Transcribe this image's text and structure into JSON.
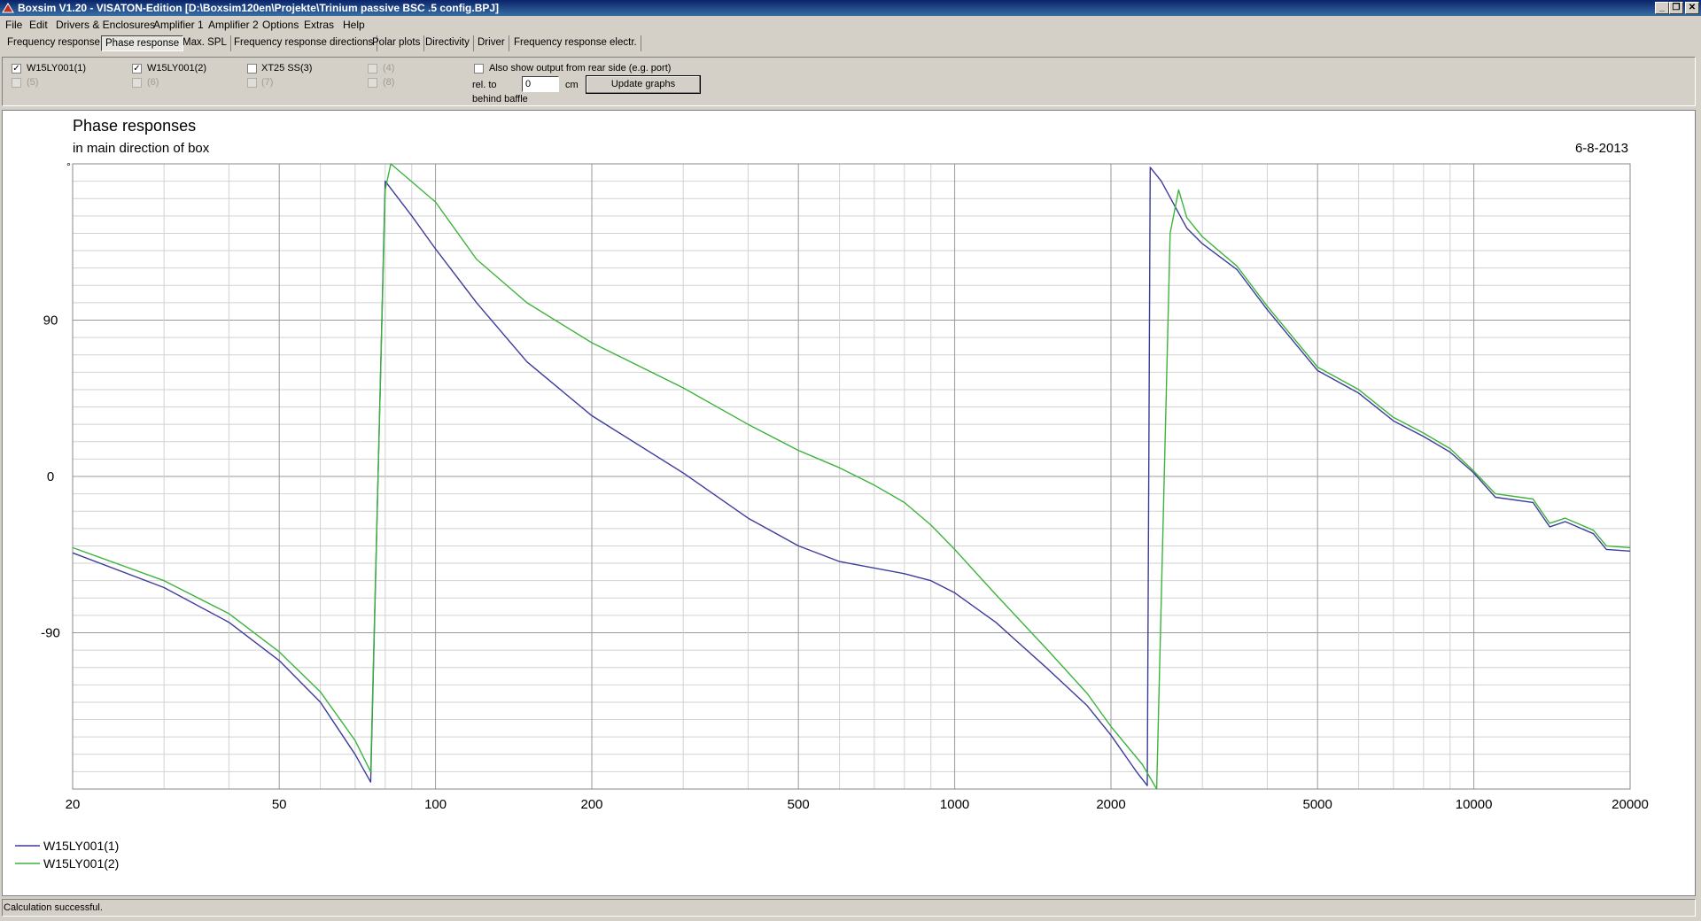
{
  "window": {
    "title": "Boxsim V1.20 - VISATON-Edition [D:\\Boxsim120en\\Projekte\\Trinium passive BSC .5 config.BPJ]",
    "buttons": [
      "_",
      "❐",
      "✕"
    ]
  },
  "menu": [
    "File",
    "Edit",
    "Drivers & Enclosures",
    "Amplifier 1",
    "Amplifier 2",
    "Options",
    "Extras",
    "Help"
  ],
  "tabs": [
    {
      "label": "Frequency response",
      "active": false
    },
    {
      "label": "Phase response",
      "active": true
    },
    {
      "label": "Max. SPL",
      "active": false
    },
    {
      "label": "Frequency response directions",
      "active": false
    },
    {
      "label": "Polar plots",
      "active": false
    },
    {
      "label": "Directivity",
      "active": false
    },
    {
      "label": "Driver",
      "active": false
    },
    {
      "label": "Frequency response electr.",
      "active": false
    }
  ],
  "drivers": [
    {
      "label": "W15LY001(1)",
      "checked": true,
      "enabled": true
    },
    {
      "label": "W15LY001(2)",
      "checked": true,
      "enabled": true
    },
    {
      "label": "XT25 SS(3)",
      "checked": false,
      "enabled": true
    },
    {
      "label": "(4)",
      "checked": false,
      "enabled": false
    },
    {
      "label": "(5)",
      "checked": false,
      "enabled": false
    },
    {
      "label": "(6)",
      "checked": false,
      "enabled": false
    },
    {
      "label": "(7)",
      "checked": false,
      "enabled": false
    },
    {
      "label": "(8)",
      "checked": false,
      "enabled": false
    }
  ],
  "rear": {
    "label": "Also show output from rear side (e.g. port)",
    "checked": false,
    "rel_to": "rel. to",
    "behind": "behind baffle",
    "value": "0",
    "unit": "cm",
    "update_label": "Update graphs"
  },
  "status": "Calculation successful.",
  "colors": {
    "series1": "#3c3c9c",
    "series2": "#3cb43c"
  },
  "chart_data": {
    "type": "line",
    "title": "Phase responses",
    "subtitle": "in main direction of box",
    "date": "6-8-2013",
    "ylabel": "°",
    "xscale": "log",
    "xlim": [
      20,
      20000
    ],
    "ylim": [
      -180,
      180
    ],
    "xticks": [
      20,
      50,
      100,
      200,
      500,
      1000,
      2000,
      5000,
      10000,
      20000
    ],
    "yticks": [
      90,
      0,
      -90
    ],
    "grid": true,
    "legend": "bottom-left",
    "series": [
      {
        "name": "W15LY001(1)",
        "points": [
          [
            20,
            -44
          ],
          [
            30,
            -64
          ],
          [
            40,
            -84
          ],
          [
            50,
            -106
          ],
          [
            60,
            -130
          ],
          [
            70,
            -160
          ],
          [
            75,
            -176
          ],
          [
            80,
            170
          ],
          [
            90,
            150
          ],
          [
            100,
            131
          ],
          [
            120,
            100
          ],
          [
            150,
            66
          ],
          [
            200,
            35
          ],
          [
            300,
            2
          ],
          [
            400,
            -24
          ],
          [
            500,
            -40
          ],
          [
            600,
            -49
          ],
          [
            800,
            -56
          ],
          [
            900,
            -60
          ],
          [
            1000,
            -67
          ],
          [
            1200,
            -84
          ],
          [
            1500,
            -110
          ],
          [
            1800,
            -132
          ],
          [
            2000,
            -149
          ],
          [
            2240,
            -170
          ],
          [
            2350,
            -178
          ],
          [
            2380,
            178
          ],
          [
            2500,
            170
          ],
          [
            2800,
            143
          ],
          [
            3000,
            134
          ],
          [
            3500,
            119
          ],
          [
            4000,
            96
          ],
          [
            5000,
            61
          ],
          [
            6000,
            48
          ],
          [
            7000,
            32
          ],
          [
            8000,
            23
          ],
          [
            9000,
            14
          ],
          [
            10000,
            2
          ],
          [
            11000,
            -12
          ],
          [
            13000,
            -15
          ],
          [
            14000,
            -29
          ],
          [
            15000,
            -26
          ],
          [
            17000,
            -33
          ],
          [
            18000,
            -42
          ],
          [
            20000,
            -43
          ]
        ]
      },
      {
        "name": "W15LY001(2)",
        "points": [
          [
            20,
            -41
          ],
          [
            30,
            -60
          ],
          [
            40,
            -79
          ],
          [
            50,
            -101
          ],
          [
            60,
            -124
          ],
          [
            70,
            -152
          ],
          [
            75,
            -170
          ],
          [
            80,
            165
          ],
          [
            82,
            180
          ],
          [
            100,
            158
          ],
          [
            120,
            125
          ],
          [
            150,
            100
          ],
          [
            200,
            77
          ],
          [
            300,
            51
          ],
          [
            400,
            30
          ],
          [
            500,
            15
          ],
          [
            600,
            5
          ],
          [
            700,
            -5
          ],
          [
            800,
            -15
          ],
          [
            900,
            -28
          ],
          [
            1000,
            -42
          ],
          [
            1200,
            -68
          ],
          [
            1500,
            -99
          ],
          [
            1800,
            -125
          ],
          [
            2000,
            -144
          ],
          [
            2300,
            -166
          ],
          [
            2450,
            -180
          ],
          [
            2600,
            140
          ],
          [
            2700,
            165
          ],
          [
            2800,
            149
          ],
          [
            3000,
            138
          ],
          [
            3500,
            121
          ],
          [
            4000,
            98
          ],
          [
            5000,
            63
          ],
          [
            6000,
            50
          ],
          [
            7000,
            34
          ],
          [
            8000,
            25
          ],
          [
            9000,
            16
          ],
          [
            10000,
            3
          ],
          [
            11000,
            -10
          ],
          [
            13000,
            -13
          ],
          [
            14000,
            -27
          ],
          [
            15000,
            -24
          ],
          [
            17000,
            -31
          ],
          [
            18000,
            -40
          ],
          [
            20000,
            -41
          ]
        ]
      }
    ]
  }
}
